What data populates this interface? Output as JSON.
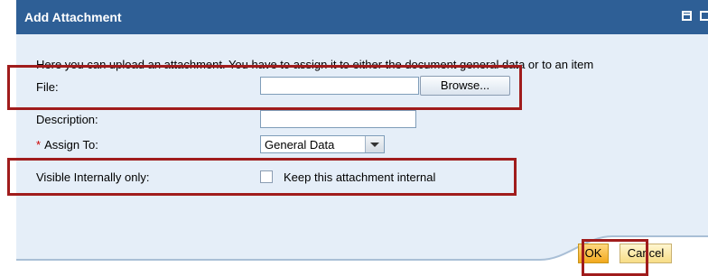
{
  "dialog": {
    "title": "Add Attachment",
    "intro": "Here you can upload an attachment. You have to assign it to either the document general data or to an item"
  },
  "form": {
    "file_label": "File:",
    "file_value": "",
    "browse_label": "Browse...",
    "description_label": "Description:",
    "description_value": "",
    "required_marker": "*",
    "assign_label": "Assign To:",
    "assign_value": "General Data",
    "visible_label": "Visible Internally only:",
    "checkbox_label": "Keep this attachment internal",
    "checkbox_checked": false
  },
  "footer": {
    "ok_label": "OK",
    "cancel_label": "Cancel"
  },
  "colors": {
    "title_bar": "#2e5f96",
    "panel": "#e5eef8",
    "highlight": "#a01c1c",
    "ok_button": "#f2a91e"
  }
}
